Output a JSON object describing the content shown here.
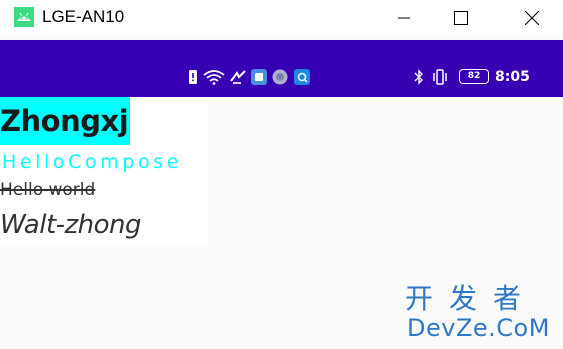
{
  "window": {
    "title": "LGE-AN10",
    "icons": {
      "app": "android-app-icon",
      "minimize": "minimize-icon",
      "maximize": "maximize-icon",
      "close": "close-icon"
    }
  },
  "status_bar": {
    "background": "#3700b3",
    "time": "8:05",
    "battery_level": "82",
    "icons": [
      "notification-icon",
      "wifi-icon",
      "signal-icon",
      "app-icon",
      "app-icon",
      "app-icon",
      "bluetooth-icon",
      "vibrate-icon",
      "battery-icon"
    ]
  },
  "content": {
    "text1": "Zhongxj",
    "text2": "HelloCompose",
    "text3": "Hello world",
    "text4": "Walt-zhong",
    "highlight_color": "#00ffff"
  },
  "watermark": {
    "top": "开发者",
    "bottom": "DevZe.CoM"
  }
}
